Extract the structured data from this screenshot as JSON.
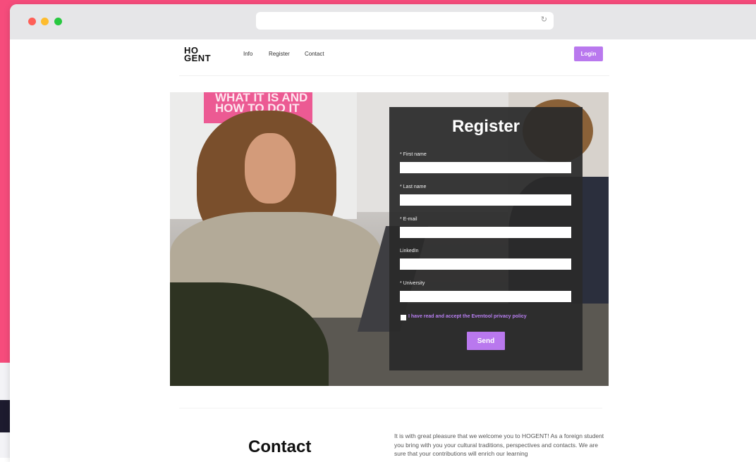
{
  "nav": {
    "logo_line1": "HO",
    "logo_line2": "GENT",
    "items": [
      "Info",
      "Register",
      "Contact"
    ],
    "login_label": "Login"
  },
  "hero": {
    "sign_line1": "WHAT IT IS AND",
    "sign_line2": "HOW TO DO IT"
  },
  "register_form": {
    "title": "Register",
    "fields": [
      {
        "label": "* First name",
        "value": ""
      },
      {
        "label": "* Last name",
        "value": ""
      },
      {
        "label": "* E-mail",
        "value": ""
      },
      {
        "label": "LinkedIn",
        "value": ""
      },
      {
        "label": "* University",
        "value": ""
      }
    ],
    "consent_text": "I have read and accept the Eventool privacy policy",
    "consent_checked": false,
    "submit_label": "Send"
  },
  "contact": {
    "heading": "Contact",
    "body": "It is with great pleasure that we welcome you to HOGENT! As a foreign student you bring with you your cultural traditions, perspectives and contacts. We are sure that your contributions will enrich our learning"
  },
  "colors": {
    "accent": "#b978ee",
    "backdrop": "#f64c7c",
    "panel": "#2a2a2a"
  }
}
